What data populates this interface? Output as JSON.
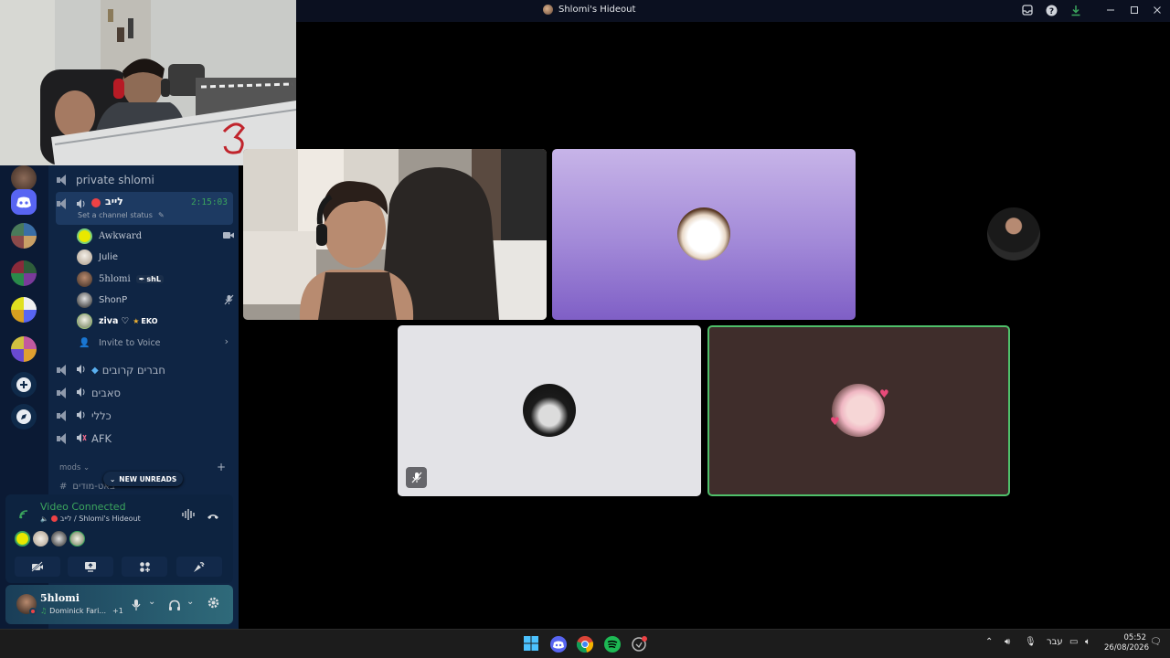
{
  "window": {
    "title": "Shlomi's Hideout"
  },
  "channels": {
    "private_label": "private shlomi",
    "live_channel": {
      "name": "לייב",
      "timer": "2:15:03",
      "status_placeholder": "Set a channel status"
    },
    "members": [
      {
        "name": "Awkward",
        "color": "#e8e800",
        "tag": ""
      },
      {
        "name": "Julie",
        "color": "#cfc8c0",
        "tag": ""
      },
      {
        "name": "5hlomi",
        "color": "#6b4a37",
        "tag": "shL"
      },
      {
        "name": "ShonP",
        "color": "#4d4d4d",
        "tag": ""
      },
      {
        "name": "ziva ♡",
        "color": "#8ea36a",
        "tag": "EKO"
      }
    ],
    "invite_label": "Invite to Voice",
    "voice_channels": [
      "חברים קרובים",
      "סאבים",
      "כללי",
      "AFK"
    ],
    "category_label": "mods",
    "new_unreads_label": "NEW UNREADS",
    "hidden_channel_label": "באט-מודים"
  },
  "voice_panel": {
    "status": "Video Connected",
    "location": "לייב / Shlomi's Hideout"
  },
  "user_panel": {
    "username": "5hlomi",
    "activity": "Dominick Fari...",
    "extra_count": "+1"
  },
  "taskbar": {
    "language": "עבר",
    "time": "05:52",
    "date": "26/08/2026"
  },
  "colors": {
    "accent_green": "#3ba55d",
    "live_red": "#ed4245",
    "brand": "#5865f2"
  }
}
